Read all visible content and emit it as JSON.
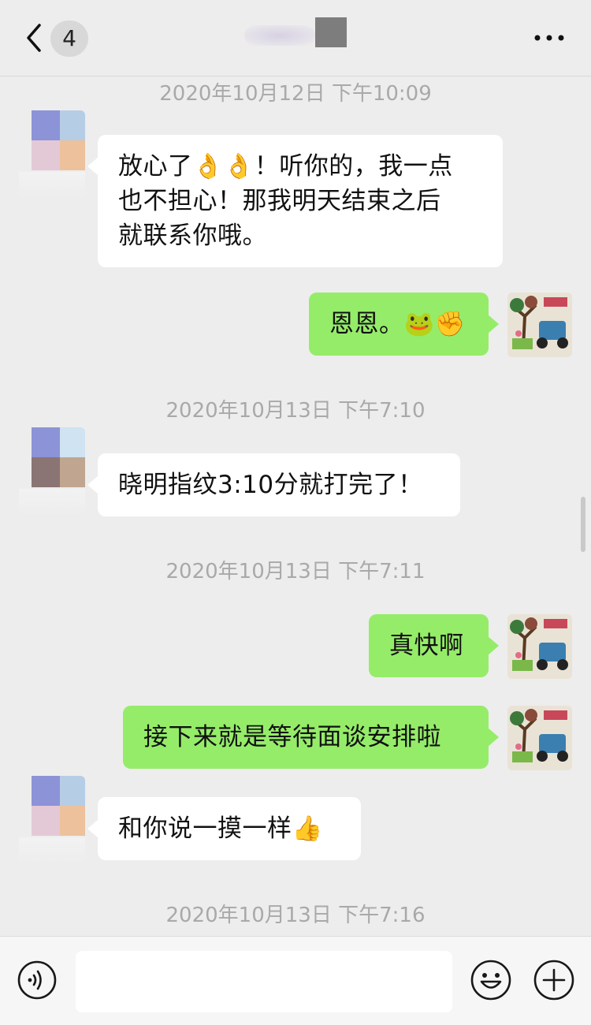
{
  "header": {
    "unread_count": "4",
    "more_label": "•••"
  },
  "messages": [
    {
      "type": "timestamp",
      "text": "2020年10月12日 下午10:09"
    },
    {
      "type": "incoming",
      "lines": [
        "放心了👌👌！听你的，我一点",
        "也不担心！那我明天结束之后",
        "就联系你哦。"
      ]
    },
    {
      "type": "outgoing",
      "text": "恩恩。🐸✊"
    },
    {
      "type": "timestamp",
      "text": "2020年10月13日 下午7:10"
    },
    {
      "type": "incoming",
      "text": "晓明指纹3:10分就打完了！"
    },
    {
      "type": "timestamp",
      "text": "2020年10月13日 下午7:11"
    },
    {
      "type": "outgoing",
      "text": "真快啊"
    },
    {
      "type": "outgoing",
      "text": "接下来就是等待面谈安排啦"
    },
    {
      "type": "incoming",
      "text": "和你说一摸一样👍"
    },
    {
      "type": "timestamp",
      "text": "2020年10月13日 下午7:16"
    }
  ],
  "input": {
    "placeholder": ""
  },
  "colors": {
    "background": "#ededed",
    "outgoing_bubble": "#95ec69",
    "incoming_bubble": "#ffffff",
    "timestamp_text": "#a9a9a9"
  },
  "icons": {
    "back": "chevron-left-icon",
    "more": "more-icon",
    "voice": "voice-icon",
    "emoji": "smiley-icon",
    "plus": "plus-icon"
  }
}
